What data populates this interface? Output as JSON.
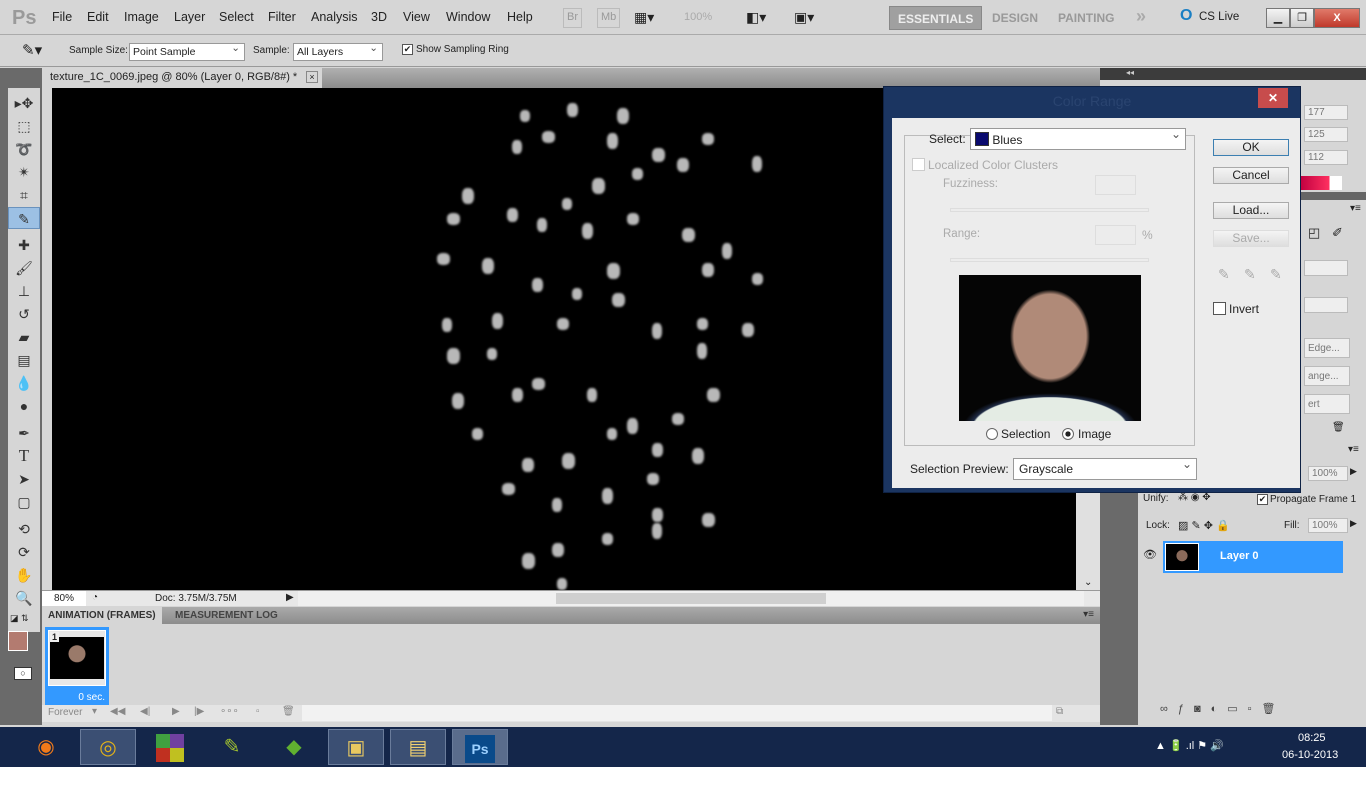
{
  "app": {
    "logo": "Ps",
    "menu": [
      "File",
      "Edit",
      "Image",
      "Layer",
      "Select",
      "Filter",
      "Analysis",
      "3D",
      "View",
      "Window",
      "Help"
    ],
    "bridge": "Br",
    "minibridge": "Mb",
    "zoom": "100%",
    "workspaces": [
      "ESSENTIALS",
      "DESIGN",
      "PAINTING"
    ],
    "more": "»",
    "cs_live": "CS Live"
  },
  "options": {
    "sample_size_label": "Sample Size:",
    "sample_size": "Point Sample",
    "sample_label": "Sample:",
    "sample": "All Layers",
    "show_ring": "Show Sampling Ring",
    "show_ring_checked": true
  },
  "document": {
    "tab": "texture_1C_0069.jpeg @ 80% (Layer 0, RGB/8#) *",
    "zoom": "80%",
    "doc_size": "Doc: 3.75M/3.75M"
  },
  "colors": {
    "foreground": "#b37b70",
    "background": "#b37b70",
    "accent": "#3399ff",
    "dialog_frame": "#1b3561"
  },
  "animation": {
    "tabs": [
      "ANIMATION (FRAMES)",
      "MEASUREMENT LOG"
    ],
    "frame_number": "1",
    "frame_delay": "0 sec.",
    "loop": "Forever"
  },
  "color_panel": {
    "values": [
      "177",
      "125",
      "112"
    ]
  },
  "masks_panel": {
    "buttons": [
      "Edge...",
      "ange...",
      "ert"
    ]
  },
  "layers": {
    "opacity": "100%",
    "unify_label": "Unify:",
    "propagate": "Propagate Frame 1",
    "lock_label": "Lock:",
    "fill_label": "Fill:",
    "fill": "100%",
    "layer_name": "Layer 0"
  },
  "dialog": {
    "title": "Color Range",
    "select_label": "Select:",
    "select_value": "Blues",
    "select_swatch": "#0a0a6e",
    "localized": "Localized Color Clusters",
    "fuzziness": "Fuzziness:",
    "range": "Range:",
    "percent": "%",
    "ok": "OK",
    "cancel": "Cancel",
    "load": "Load...",
    "save": "Save...",
    "invert": "Invert",
    "radio_selection": "Selection",
    "radio_image": "Image",
    "radio_selected": "Image",
    "preview_label": "Selection Preview:",
    "preview_value": "Grayscale"
  },
  "taskbar": {
    "apps": [
      "firefox",
      "chrome",
      "windows",
      "python-idle",
      "bluestacks",
      "notepad-plus",
      "explorer",
      "photoshop"
    ],
    "ps_label": "Ps",
    "time": "08:25",
    "date": "06-10-2013"
  }
}
